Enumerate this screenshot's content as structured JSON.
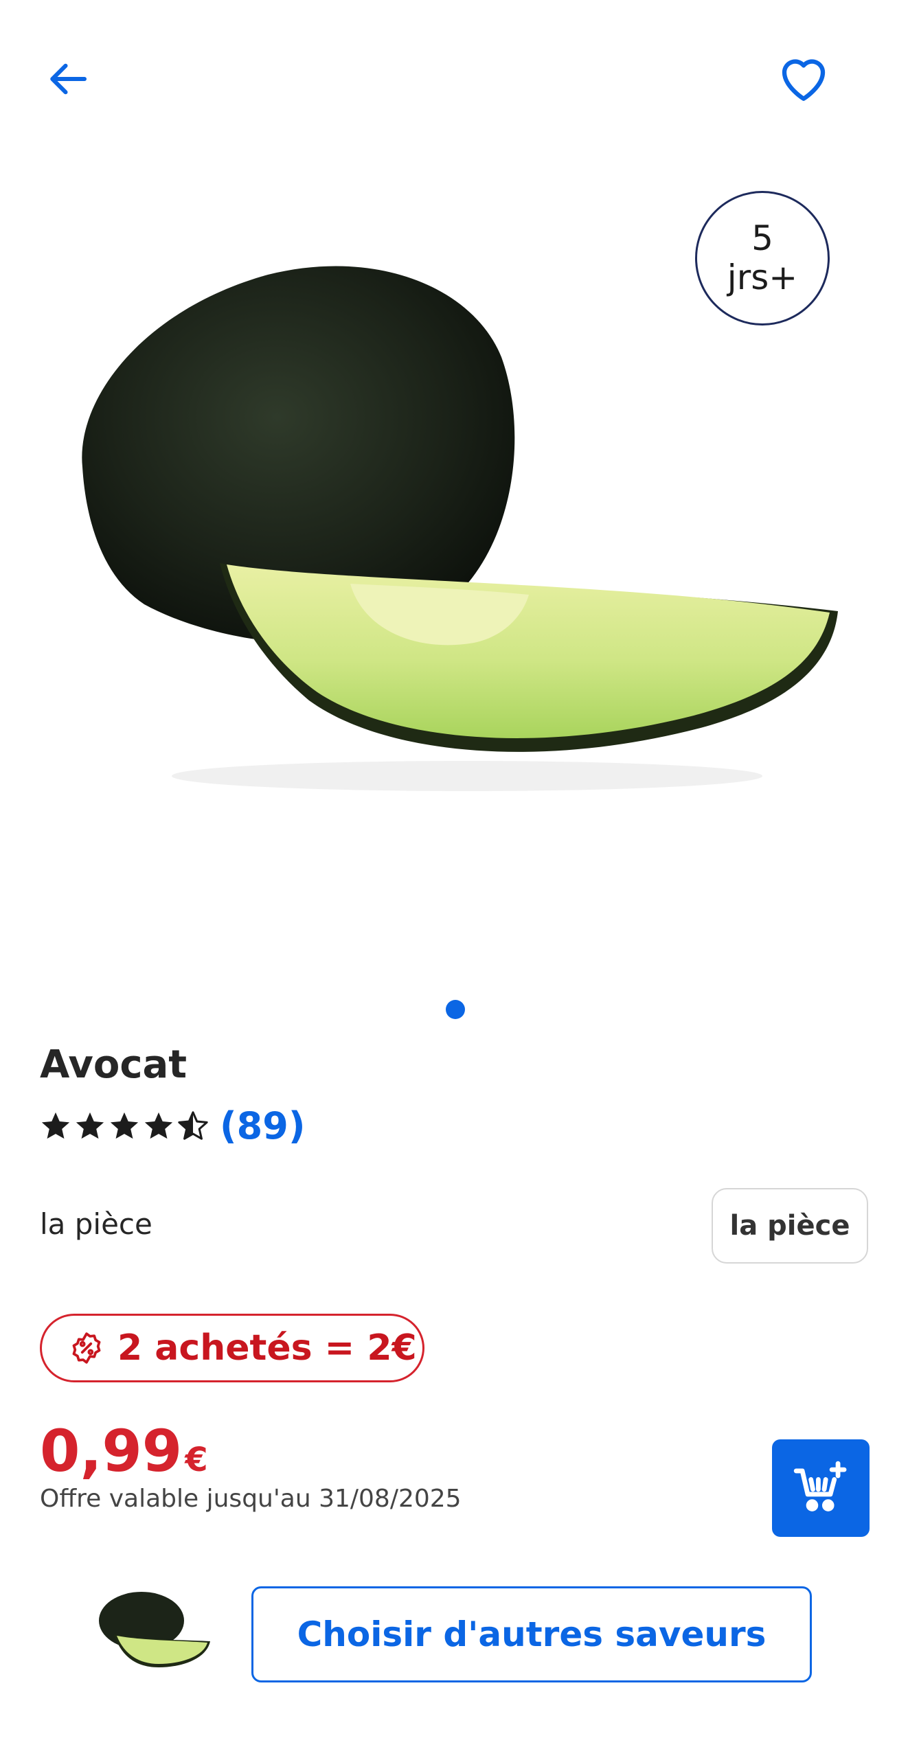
{
  "header": {
    "back_icon": "arrow-left-icon",
    "favorite_icon": "heart-icon",
    "accent_color": "#0b66e4"
  },
  "freshness_badge": {
    "number": "5",
    "unit": "jrs+"
  },
  "carousel": {
    "image": "avocado-photo",
    "active_index": 1,
    "count": 1
  },
  "product": {
    "title": "Avocat",
    "rating": {
      "stars": 4.5,
      "max": 5,
      "count_label": "(89)"
    },
    "unit_label": "la pièce",
    "unit_select": "la pièce",
    "promo": {
      "icon": "percent-tag-icon",
      "text": "2 achetés = 2€",
      "color": "#d5232d"
    },
    "price": {
      "main": "0,99",
      "currency": "€",
      "color": "#d5232d"
    },
    "offer_validity": "Offre valable jusqu'au 31/08/2025"
  },
  "actions": {
    "add_to_cart_icon": "cart-plus-icon",
    "other_flavors_label": "Choisir d'autres saveurs"
  }
}
